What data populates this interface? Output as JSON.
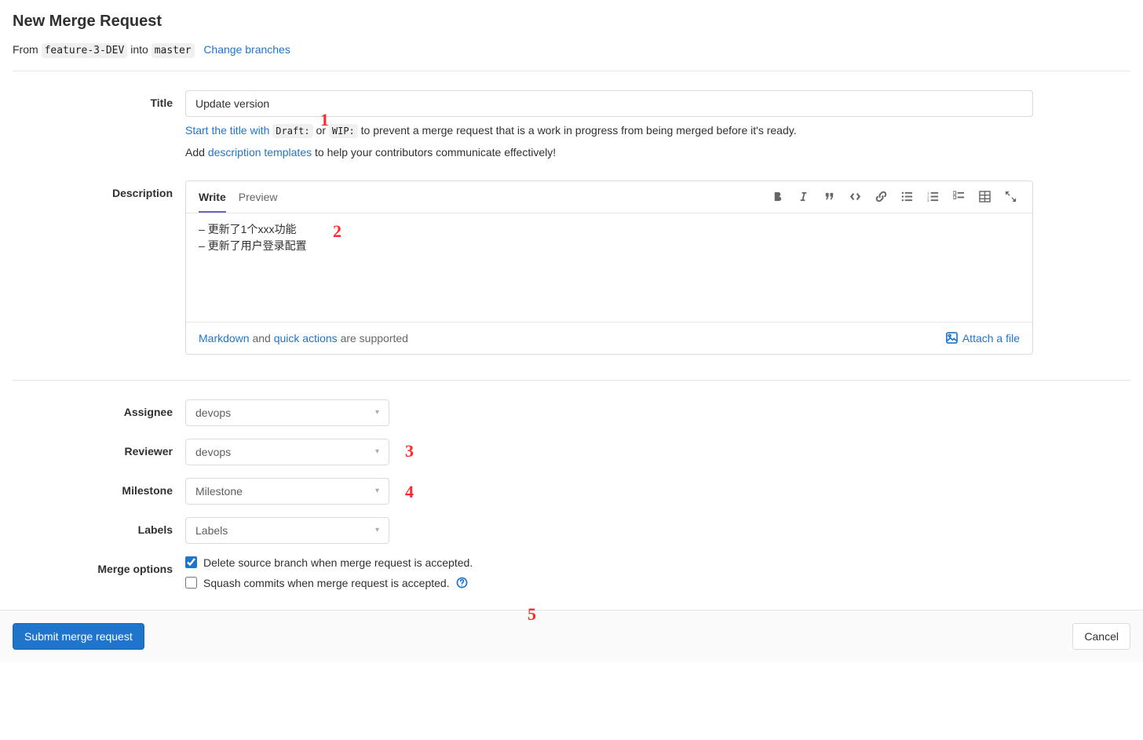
{
  "header": {
    "title": "New Merge Request",
    "from_word": "From",
    "into_word": "into",
    "source_branch": "feature-3-DEV",
    "target_branch": "master",
    "change_branches": "Change branches"
  },
  "title": {
    "label": "Title",
    "value": "Update version",
    "hint_prefix": "Start the title with",
    "hint_draft": "Draft:",
    "hint_or": "or",
    "hint_wip": "WIP:",
    "hint_suffix": "to prevent a merge request that is a work in progress from being merged before it's ready.",
    "hint2_prefix": "Add",
    "hint2_link": "description templates",
    "hint2_suffix": "to help your contributors communicate effectively!"
  },
  "description": {
    "label": "Description",
    "tab_write": "Write",
    "tab_preview": "Preview",
    "content_lines": [
      "更新了1个xxx功能",
      "更新了用户登录配置"
    ],
    "markdown_word": "Markdown",
    "and_word": "and",
    "quick_actions": "quick actions",
    "supported_suffix": "are supported",
    "attach": "Attach a file"
  },
  "assignee": {
    "label": "Assignee",
    "value": "devops"
  },
  "reviewer": {
    "label": "Reviewer",
    "value": "devops"
  },
  "milestone": {
    "label": "Milestone",
    "value": "Milestone"
  },
  "labels": {
    "label": "Labels",
    "value": "Labels"
  },
  "merge_options": {
    "label": "Merge options",
    "delete_branch": "Delete source branch when merge request is accepted.",
    "squash": "Squash commits when merge request is accepted."
  },
  "actions": {
    "submit": "Submit merge request",
    "cancel": "Cancel"
  },
  "annotations": {
    "a1": "1",
    "a2": "2",
    "a3": "3",
    "a4": "4",
    "a5": "5"
  }
}
